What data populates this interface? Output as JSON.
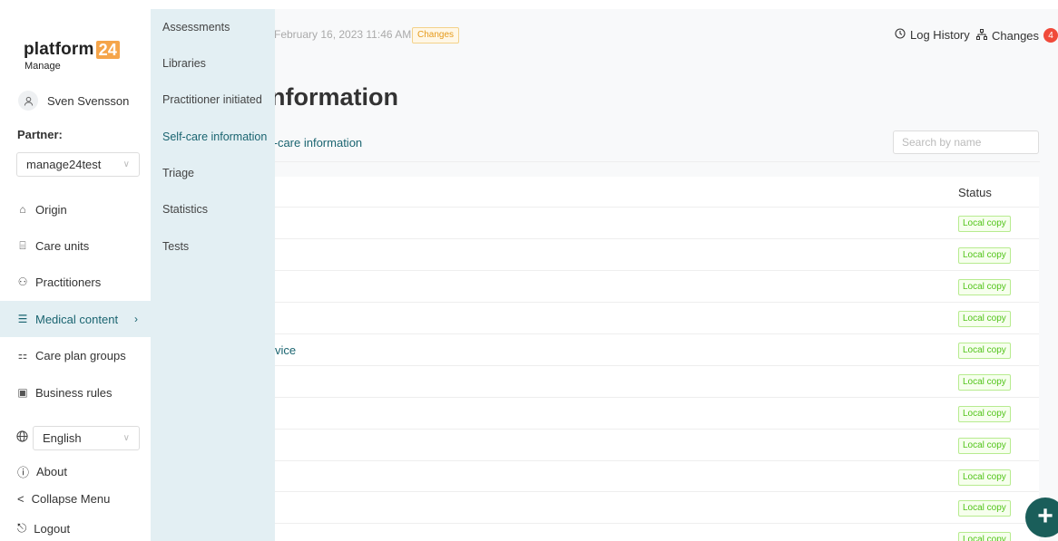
{
  "logo": {
    "text": "platform",
    "badge": "24",
    "sub": "Manage"
  },
  "user": {
    "name": "Sven Svensson"
  },
  "partner": {
    "label": "Partner:",
    "value": "manage24test"
  },
  "nav": [
    {
      "label": "Origin",
      "icon": "home-icon"
    },
    {
      "label": "Care units",
      "icon": "bank-icon"
    },
    {
      "label": "Practitioners",
      "icon": "users-icon"
    },
    {
      "label": "Medical content",
      "icon": "content-icon"
    },
    {
      "label": "Care plan groups",
      "icon": "groups-icon"
    },
    {
      "label": "Business rules",
      "icon": "rules-icon"
    }
  ],
  "language": {
    "value": "English"
  },
  "bottom": {
    "about": "About",
    "collapse": "Collapse Menu",
    "logout": "Logout"
  },
  "submenu": [
    "Assessments",
    "Libraries",
    "Practitioner initiated",
    "Self-care information",
    "Triage",
    "Statistics",
    "Tests"
  ],
  "header": {
    "date": "February 16, 2023 11:46 AM",
    "changes_tag": "Changes",
    "log_history": "Log History",
    "changes": "Changes",
    "changes_count": "4"
  },
  "page": {
    "title": "nformation",
    "breadcrumb": "f-care information",
    "search_placeholder": "Search by name"
  },
  "table": {
    "status_header": "Status",
    "rows": [
      {
        "name": "",
        "status": "Local copy"
      },
      {
        "name": "",
        "status": "Local copy"
      },
      {
        "name": "",
        "status": "Local copy"
      },
      {
        "name": "",
        "status": "Local copy"
      },
      {
        "name": "vice",
        "status": "Local copy"
      },
      {
        "name": "",
        "status": "Local copy"
      },
      {
        "name": "",
        "status": "Local copy"
      },
      {
        "name": "",
        "status": "Local copy"
      },
      {
        "name": "",
        "status": "Local copy"
      },
      {
        "name": "",
        "status": "Local copy"
      },
      {
        "name": "",
        "status": "Local copy"
      }
    ]
  },
  "fab": {
    "symbol": "+"
  }
}
